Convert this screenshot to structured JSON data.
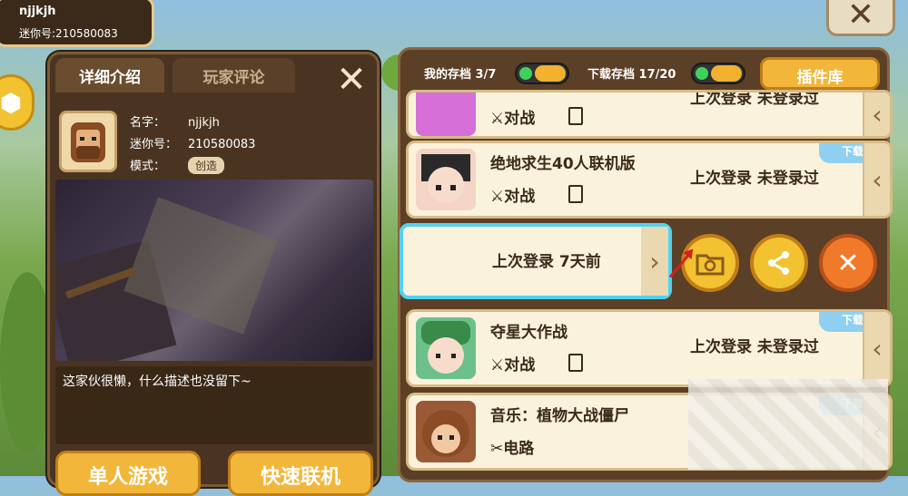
{
  "profile": {
    "name": "njjkjh",
    "mini_id_line": "迷你号:210580083"
  },
  "left_panel": {
    "tabs": [
      "详细介绍",
      "玩家评论"
    ],
    "labels": {
      "name": "名字：",
      "mini": "迷你号：",
      "mode": "模式："
    },
    "values": {
      "name": "njjkjh",
      "mini": "210580083",
      "mode": "创造"
    },
    "description": "这家伙很懒，什么描述也没留下~",
    "buttons": {
      "single": "单人游戏",
      "quick": "快速联机"
    }
  },
  "right_panel": {
    "my_saves": "我的存档 3/7",
    "downloads": "下载存档 17/20",
    "plugin": "插件库",
    "cards": [
      {
        "title": "",
        "mode": "对战",
        "last": "上次登录  未登录过",
        "badge": ""
      },
      {
        "title": "绝地求生40人联机版",
        "mode": "对战",
        "last": "上次登录  未登录过",
        "badge": "下载"
      },
      {
        "title": "",
        "mode": "",
        "last": "上次登录  7天前",
        "badge": ""
      },
      {
        "title": "夺星大作战",
        "mode": "对战",
        "last": "上次登录  未登录过",
        "badge": "下载"
      },
      {
        "title": "音乐：植物大战僵尸",
        "mode": "电路",
        "last": "",
        "badge": "下载"
      }
    ]
  },
  "icons": {
    "close": "close-icon",
    "folder": "folder-restore-icon",
    "share": "share-icon",
    "delete": "delete-icon",
    "chevron": "chevron-left-icon",
    "swords": "swords-icon",
    "tool": "wrench-icon"
  },
  "colors": {
    "accent": "#f2b63a",
    "highlight": "#4fd2f2",
    "badge": "#8fd0f2",
    "panel": "#5b3f26"
  }
}
